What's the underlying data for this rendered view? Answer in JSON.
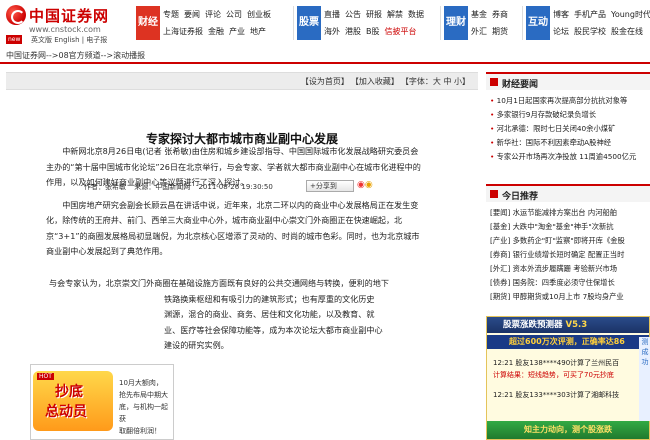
{
  "site": {
    "name": "中国证券网",
    "url": "www.cnstock.com",
    "new_badge": "new",
    "header_links": "英文版 English | 电子报"
  },
  "nav": {
    "caijing": {
      "label": "财经",
      "row1": [
        "专题",
        "要闻",
        "评论",
        "公司",
        "创业板"
      ],
      "row2": [
        "上海证券报",
        "金融",
        "产业",
        "地产"
      ]
    },
    "gupiao": {
      "label": "股票",
      "row1": [
        "直播",
        "公告",
        "研报",
        "解禁",
        "数据"
      ],
      "row2": [
        "海外",
        "港股",
        "B股",
        "信披平台"
      ]
    },
    "licai": {
      "label": "理财",
      "row1": [
        "基金",
        "券商"
      ],
      "row2": [
        "外汇",
        "期货"
      ]
    },
    "hudong": {
      "label": "互动",
      "row1": [
        "博客",
        "手机产品",
        "Young时代"
      ],
      "row2": [
        "论坛",
        "股民学校",
        "股金在线"
      ]
    }
  },
  "breadcrumb": "中国证券网-->08官方频道-->滚动播报",
  "toolbar": {
    "set_home": "【设为首页】",
    "add_fav": "【加入收藏】",
    "font_size": "【字体：大 中 小】"
  },
  "article": {
    "title": "专家探讨大都市城市商业副中心发展",
    "author": "作者：张希敏",
    "source": "来源：中国新闻网",
    "datetime": "2011-08-26 19:30:50",
    "share_label": "分享到",
    "paragraphs": [
      "中新网北京8月26日电(记者 张希敏)由住房和城乡建设部指导、中国国际城市化发展战略研究委员会主办的“第十届中国城市化论坛”26日在北京举行，与会专家、学者就大都市商业副中心在城市化进程中的作用，以及如何建好商业副中心等议题进行了深入探讨。",
      "中国房地产研究会副会长顾云昌在讲话中说，近年来，北京二环以内的商业中心发展格局正在发生变化，除传统的王府井、前门、西单三大商业中心外，城市商业副中心崇文门外商圈正在快速崛起，北京“3+1”的商圈发展格局初显端倪，为北京核心区增添了灵动的、时尚的城市色彩。同时，也为北京城市商业副中心发展起到了典范作用。"
    ],
    "para4_lines": [
      "与会专家认为，北京崇文门外商圈在基础设施方面既有良好的公共交通网络与转换，便利的地下",
      "铁路换乘枢纽和有吸引力的建筑形式；也有厚重的文化历史",
      "渊源，混合的商业、商务、居住和文化功能，以及教育、就",
      "业、医疗等社会保障功能等，成为本次论坛大都市商业副中心",
      "建设的研究实例。"
    ]
  },
  "ad": {
    "tag": "HOT",
    "title1": "抄底",
    "title2": "总动员",
    "desc": [
      "10月大额肉，",
      "抢先布局中期大",
      "底，与机构一起获",
      "取翻倍利润！"
    ]
  },
  "sidebar": {
    "news_heading": "财经要闻",
    "news": [
      "10月1日起国家再次提高部分抗抗对象等",
      "多家银行9月存款破纪录负增长",
      "河北承德：限时七日关闭40余小煤矿",
      "新华社：国际不利因素牵动A股神经",
      "专家公开市场再次净投放 11周逾4500亿元"
    ],
    "rec_heading": "今日推荐",
    "rec": [
      "[要闻] 水运节能减排方案出台 内河船舶",
      "[基金] 大跌中\"淘金\"基金\"神手\"次新抗",
      "[产业] 多数药企\"盯\"监察\"即将开库《金股",
      "[券商] 银行业绩增长短时确定 配置正当时",
      "[外汇] 资本外流步履蹒跚 考验新兴市场",
      "[债券] 国务院：四季度必须守住保增长",
      "[期货] 甲醇期货或10月上市 7股均身产业"
    ]
  },
  "stock_widget": {
    "title": "股票涨跌预测器",
    "version": "V5.3",
    "sub": "超过600万次评测，正确率达86",
    "rows": [
      {
        "time": "12:21",
        "text": "股友138****490计算了兰州民百",
        "note": "计算结果：短线趋势，可买了70元抄底"
      },
      {
        "time": "12:21",
        "text": "股友133****303计算了湘邮科技",
        "note": ""
      }
    ],
    "footer": "知主力动向，测个股涨跌",
    "side_text": "测成功"
  }
}
